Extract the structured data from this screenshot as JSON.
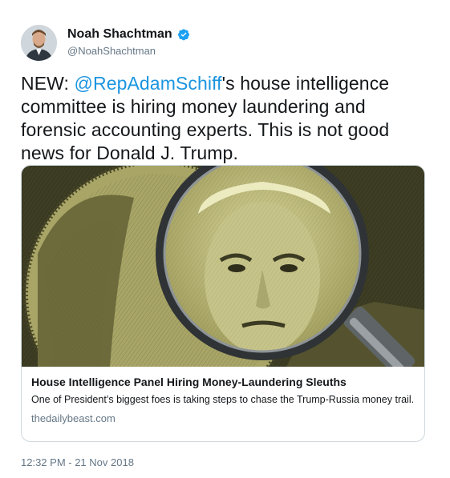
{
  "author": {
    "name": "Noah Shachtman",
    "handle": "@NoahShachtman",
    "verified": true
  },
  "tweet": {
    "prefix": "NEW: ",
    "mention": "@RepAdamSchiff",
    "suffix": "'s house intelligence committee is hiring money laundering and forensic accounting experts. This is not good news for Donald J. Trump.",
    "timestamp": "12:32 PM - 21 Nov 2018"
  },
  "card": {
    "title": "House Intelligence Panel Hiring Money-Laundering Sleuths",
    "description": "One of President’s biggest foes is taking steps to chase the Trump-Russia money trail.",
    "domain": "thedailybeast.com"
  },
  "colors": {
    "link": "#1b95e0",
    "muted": "#657786",
    "verified": "#1da1f2",
    "image_tint": "#b8b57a"
  },
  "icons": {
    "verified": "verified-badge-icon",
    "magnifier": "magnifying-glass-icon"
  }
}
